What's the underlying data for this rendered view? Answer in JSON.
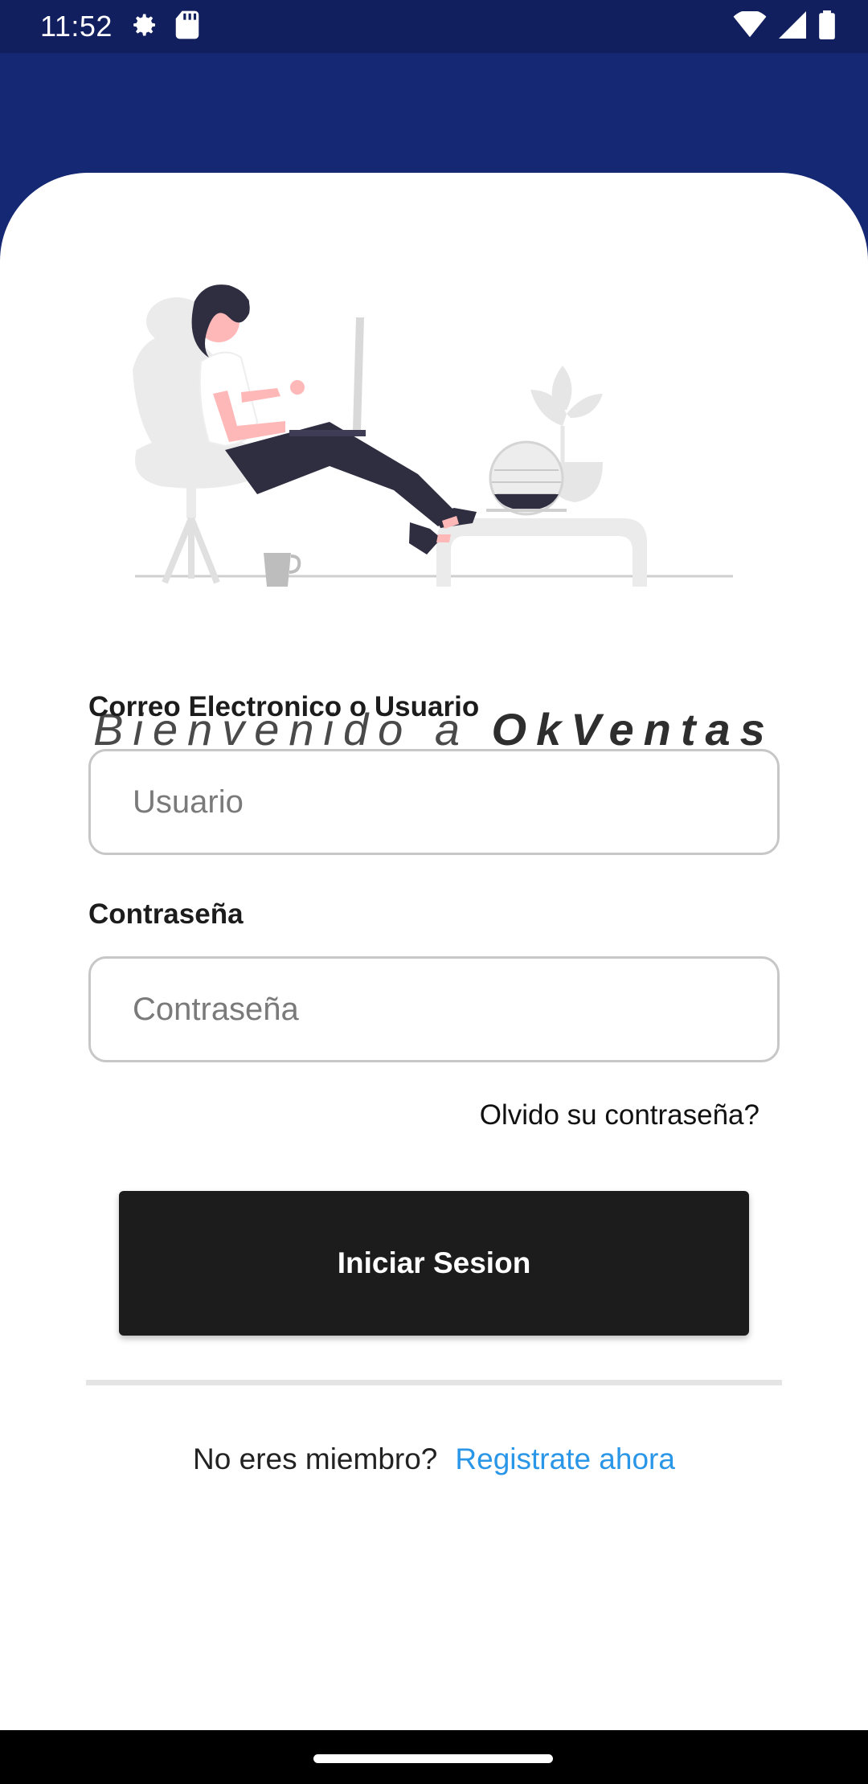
{
  "status_bar": {
    "time": "11:52",
    "icons_left": [
      "gear-icon",
      "sd-card-icon"
    ],
    "icons_right": [
      "wifi-icon",
      "signal-icon",
      "battery-icon"
    ]
  },
  "welcome": {
    "prefix": "Bienvenido a ",
    "brand": "OkVentas"
  },
  "form": {
    "user_label": "Correo Electronico o Usuario",
    "user_placeholder": "Usuario",
    "password_label": "Contraseña",
    "password_placeholder": "Contraseña",
    "forgot_label": "Olvido su contraseña?",
    "login_label": "Iniciar Sesion"
  },
  "register": {
    "question": "No eres miembro?",
    "link": "Registrate ahora"
  },
  "colors": {
    "header_blue": "#152873",
    "status_blue": "#121f5e",
    "button_dark": "#1c1c1c",
    "link_blue": "#2a96e8"
  }
}
